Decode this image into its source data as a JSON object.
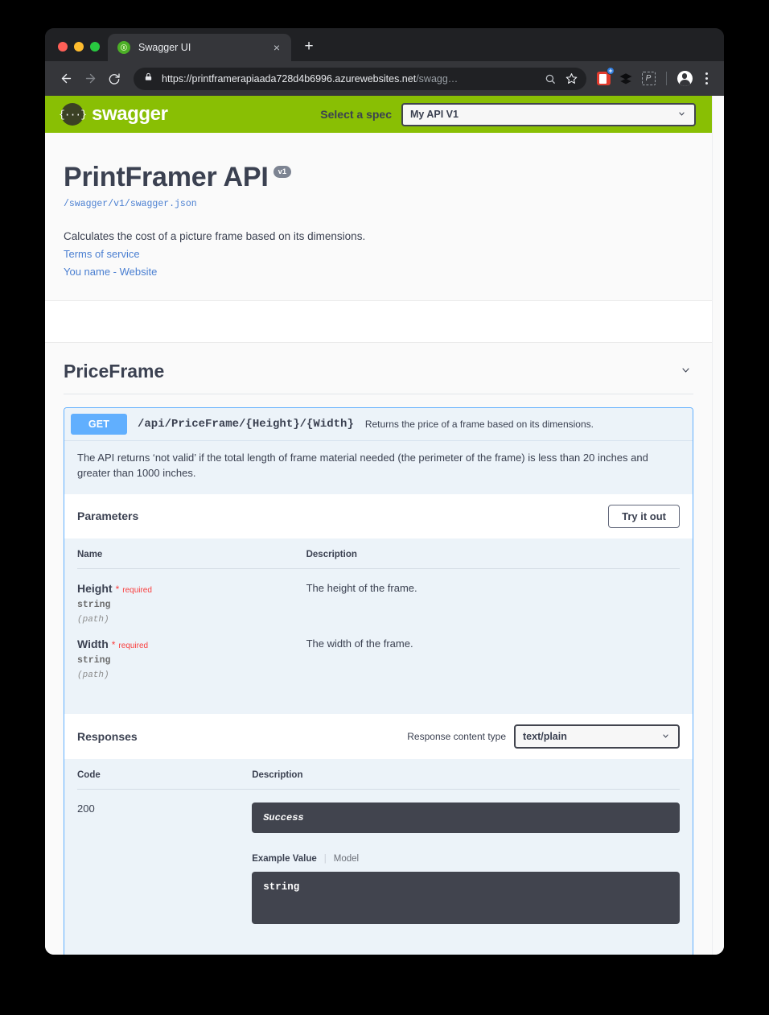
{
  "browser": {
    "tab": {
      "title": "Swagger UI",
      "favicon": "swagger-favicon",
      "close_label": "×"
    },
    "new_tab_label": "+",
    "omnibox": {
      "url_secure": "https://printframerapiaada728d4b6996.azurewebsites.net",
      "url_path": "/swagg…",
      "lock_icon": "lock-icon"
    },
    "extension_p_label": "P"
  },
  "topbar": {
    "logo_glyph": "{···}",
    "wordmark": "swagger",
    "spec_label": "Select a spec",
    "spec_selected": "My API V1",
    "chevron": "⌄"
  },
  "info": {
    "title": "PrintFramer API",
    "version_badge": "v1",
    "spec_url": "/swagger/v1/swagger.json",
    "description": "Calculates the cost of a picture frame based on its dimensions.",
    "terms_link": "Terms of service",
    "contact_link": "You name - Website"
  },
  "tag": {
    "name": "PriceFrame",
    "chevron": "⌄"
  },
  "operation": {
    "method": "GET",
    "path": "/api/PriceFrame/{Height}/{Width}",
    "summary": "Returns the price of a frame based on its dimensions.",
    "description": "The API returns ‘not valid’ if the total length of frame material needed (the perimeter of the frame) is less than 20 inches and greater than 1000 inches.",
    "parameters_heading": "Parameters",
    "try_it_out_label": "Try it out",
    "param_columns": {
      "name": "Name",
      "description": "Description"
    },
    "parameters": [
      {
        "name": "Height",
        "required_star": "*",
        "required_text": "required",
        "type": "string",
        "in": "(path)",
        "description": "The height of the frame."
      },
      {
        "name": "Width",
        "required_star": "*",
        "required_text": "required",
        "type": "string",
        "in": "(path)",
        "description": "The width of the frame."
      }
    ],
    "responses_heading": "Responses",
    "response_content_type_label": "Response content type",
    "response_content_type_value": "text/plain",
    "response_columns": {
      "code": "Code",
      "description": "Description"
    },
    "responses": [
      {
        "code": "200",
        "description": "Success",
        "example_tab": "Example Value",
        "model_tab": "Model",
        "example_value": "string"
      }
    ]
  },
  "colors": {
    "swagger_green": "#89bf04",
    "get_blue": "#61affe",
    "required_red": "#f93e3e",
    "code_box": "#41444e",
    "link_blue": "#4a7fd1"
  }
}
